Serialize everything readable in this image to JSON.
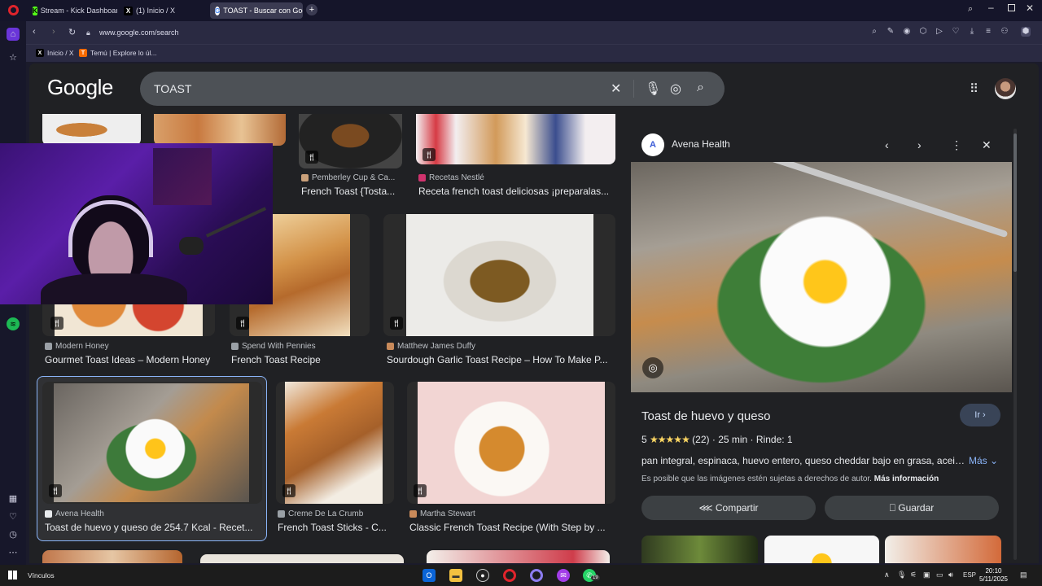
{
  "tabs": [
    {
      "label": "Stream - Kick Dashboard",
      "icon": "kick-icon"
    },
    {
      "label": "(1) Inicio / X",
      "icon": "x-icon"
    },
    {
      "label": "TOAST - Buscar con Goog",
      "icon": "google-icon"
    }
  ],
  "browser": {
    "url": "www.google.com/search",
    "bookmarks": [
      {
        "label": "Inicio / X"
      },
      {
        "label": "Temú | Explore lo úl..."
      }
    ]
  },
  "google": {
    "logo": "Google",
    "query": "TOAST"
  },
  "results": [
    {
      "source": "Pemberley Cup & Ca...",
      "title": "French Toast {Tosta..."
    },
    {
      "source": "Recetas Nestlé",
      "title": "Receta french toast deliciosas ¡preparalas..."
    },
    {
      "source": "Modern Honey",
      "title": "Gourmet Toast Ideas – Modern Honey"
    },
    {
      "source": "Spend With Pennies",
      "title": "French Toast Recipe"
    },
    {
      "source": "Matthew James Duffy",
      "title": "Sourdough Garlic Toast Recipe – How To Make P..."
    },
    {
      "source": "Avena Health",
      "title": "Toast de huevo y queso de 254.7 Kcal - Recet..."
    },
    {
      "source": "Creme De La Crumb",
      "title": "French Toast Sticks - C..."
    },
    {
      "source": "Martha Stewart",
      "title": "Classic French Toast Recipe (With Step by ..."
    }
  ],
  "panel": {
    "source": "Avena Health",
    "title": "Toast de huevo y queso",
    "go_label": "Ir",
    "rating": "5",
    "stars": "★★★★★",
    "reviews": "(22)",
    "time": "25 min",
    "yield": "Rinde: 1",
    "ingredients": "pan integral, espinaca, huevo entero, queso cheddar bajo en grasa, aceite...",
    "more": "Más",
    "copyright": "Es posible que las imágenes estén sujetas a derechos de autor.",
    "more_info": "Más información",
    "share": "Compartir",
    "save": "Guardar"
  },
  "taskbar": {
    "label": "Vínculos",
    "lang": "ESP",
    "time": "20:10",
    "date": "5/11/2025",
    "whatsapp_badge": "19"
  }
}
